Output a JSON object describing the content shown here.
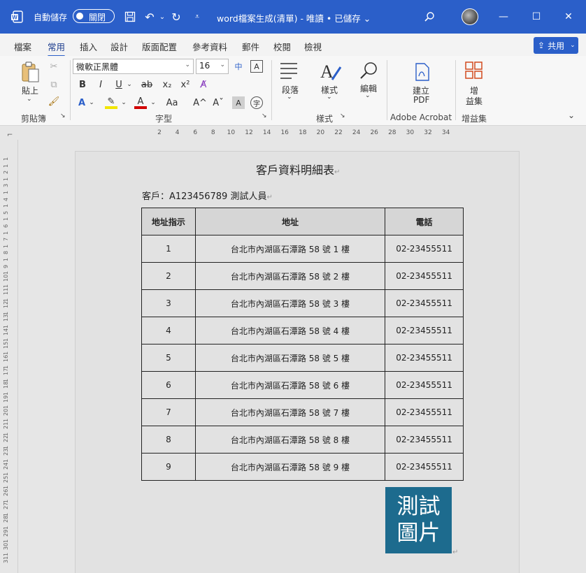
{
  "titlebar": {
    "autosave_label": "自動儲存",
    "autosave_state": "關閉",
    "doc_title": "word檔案生成(清單) - 唯讀 • 已儲存 ⌄",
    "icons": [
      "word-icon",
      "save-icon",
      "undo-icon",
      "redo-icon",
      "customize-icon",
      "search-icon",
      "minimize-icon",
      "maximize-icon",
      "close-icon"
    ]
  },
  "tabs": [
    {
      "label": "檔案"
    },
    {
      "label": "常用",
      "active": true
    },
    {
      "label": "插入"
    },
    {
      "label": "設計"
    },
    {
      "label": "版面配置"
    },
    {
      "label": "參考資料"
    },
    {
      "label": "郵件"
    },
    {
      "label": "校閱"
    },
    {
      "label": "檢視"
    }
  ],
  "share_label": "共用",
  "ribbon": {
    "paste_label": "貼上",
    "font_name": "微軟正黑體",
    "font_size": "16",
    "bold": "B",
    "italic": "I",
    "underline": "U",
    "strike": "ab",
    "subscript": "x₂",
    "superscript": "x²",
    "font_increase": "A^",
    "font_decrease": "Aˇ",
    "case": "Aa",
    "paragraph_label": "段落",
    "styles_label": "樣式",
    "edit_label": "編輯",
    "pdf_label_1": "建立",
    "pdf_label_2": "PDF",
    "addin_label_1": "增",
    "addin_label_2": "益集",
    "groups": {
      "clipboard": "剪貼簿",
      "font": "字型",
      "styles": "樣式",
      "acrobat": "Adobe Acrobat",
      "addins": "增益集"
    }
  },
  "ruler_numbers": [
    "2",
    "4",
    "6",
    "8",
    "10",
    "12",
    "14",
    "16",
    "18",
    "20",
    "22",
    "24",
    "26",
    "28",
    "30",
    "32",
    "34"
  ],
  "vruler_numbers": [
    "1",
    "1",
    "2",
    "1",
    "3",
    "1",
    "4",
    "1",
    "5",
    "1",
    "6",
    "1",
    "7",
    "1",
    "8",
    "1",
    "9",
    "1",
    "10",
    "1",
    "11",
    "1",
    "12",
    "1",
    "13",
    "1",
    "14",
    "1",
    "15",
    "1",
    "16",
    "1",
    "17",
    "1",
    "18",
    "1",
    "19",
    "1",
    "20",
    "1",
    "21",
    "1",
    "22",
    "1",
    "23",
    "1",
    "24",
    "1",
    "25",
    "1",
    "26",
    "1",
    "27",
    "1",
    "28",
    "1",
    "29",
    "1",
    "30",
    "1",
    "31"
  ],
  "document": {
    "heading": "客戶資料明細表",
    "client_line": "客戶：A123456789  測試人員",
    "table": {
      "headers": [
        "地址指示",
        "地址",
        "電話"
      ],
      "rows": [
        [
          "1",
          "台北市內湖區石潭路 58 號 1 樓",
          "02-23455511"
        ],
        [
          "2",
          "台北市內湖區石潭路 58 號 2 樓",
          "02-23455511"
        ],
        [
          "3",
          "台北市內湖區石潭路 58 號 3 樓",
          "02-23455511"
        ],
        [
          "4",
          "台北市內湖區石潭路 58 號 4 樓",
          "02-23455511"
        ],
        [
          "5",
          "台北市內湖區石潭路 58 號 5 樓",
          "02-23455511"
        ],
        [
          "6",
          "台北市內湖區石潭路 58 號 6 樓",
          "02-23455511"
        ],
        [
          "7",
          "台北市內湖區石潭路 58 號 7 樓",
          "02-23455511"
        ],
        [
          "8",
          "台北市內湖區石潭路 58 號 8 樓",
          "02-23455511"
        ],
        [
          "9",
          "台北市內湖區石潭路 58 號 9 樓",
          "02-23455511"
        ]
      ]
    },
    "image_text_1": "測試",
    "image_text_2": "圖片"
  },
  "colors": {
    "titlebar": "#2b5fc9",
    "image_bg": "#1d6b8e"
  }
}
